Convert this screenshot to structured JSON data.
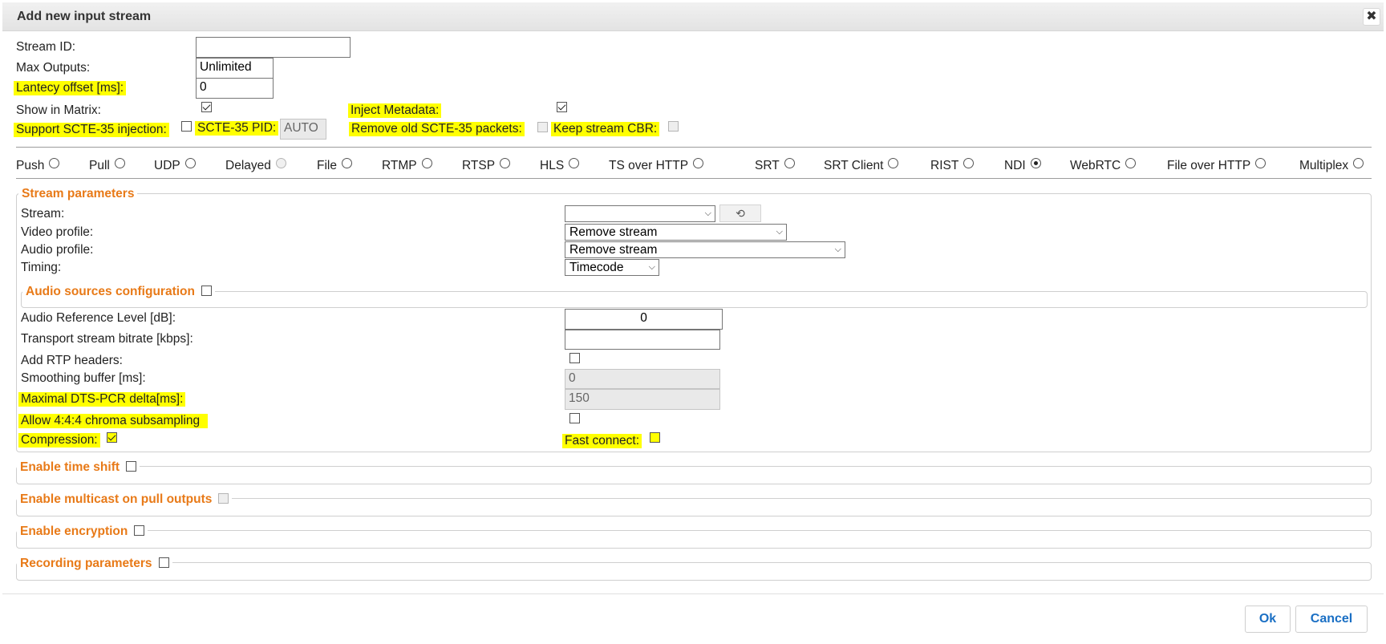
{
  "dialog": {
    "title": "Add new input stream",
    "close_icon": "close-icon"
  },
  "top": {
    "stream_id_label": "Stream ID:",
    "stream_id_value": "",
    "max_outputs_label": "Max Outputs:",
    "max_outputs_value": "Unlimited",
    "latency_label": "Lantecy offset [ms]:",
    "latency_value": "0",
    "show_matrix_label": "Show in Matrix:",
    "show_matrix_checked": true,
    "inject_metadata_label": "Inject Metadata:",
    "inject_metadata_checked": true,
    "scte_injection_label": "Support SCTE-35 injection:",
    "scte_pid_label": "SCTE-35 PID:",
    "scte_pid_value": "AUTO",
    "remove_scte_label": "Remove old SCTE-35 packets:",
    "keep_cbr_label": "Keep stream CBR:"
  },
  "protocols": [
    {
      "label": "Push",
      "selected": false,
      "disabled": false
    },
    {
      "label": "Pull",
      "selected": false,
      "disabled": false
    },
    {
      "label": "UDP",
      "selected": false,
      "disabled": false
    },
    {
      "label": "Delayed",
      "selected": false,
      "disabled": true
    },
    {
      "label": "File",
      "selected": false,
      "disabled": false
    },
    {
      "label": "RTMP",
      "selected": false,
      "disabled": false
    },
    {
      "label": "RTSP",
      "selected": false,
      "disabled": false
    },
    {
      "label": "HLS",
      "selected": false,
      "disabled": false
    },
    {
      "label": "TS over HTTP",
      "selected": false,
      "disabled": false
    },
    {
      "label": "SRT",
      "selected": false,
      "disabled": false
    },
    {
      "label": "SRT Client",
      "selected": false,
      "disabled": false
    },
    {
      "label": "RIST",
      "selected": false,
      "disabled": false
    },
    {
      "label": "NDI",
      "selected": true,
      "disabled": false
    },
    {
      "label": "WebRTC",
      "selected": false,
      "disabled": false
    },
    {
      "label": "File over HTTP",
      "selected": false,
      "disabled": false
    },
    {
      "label": "Multiplex",
      "selected": false,
      "disabled": false
    }
  ],
  "stream_params": {
    "legend": "Stream parameters",
    "stream_label": "Stream:",
    "stream_value": "",
    "refresh_icon": "refresh-icon",
    "video_profile_label": "Video profile:",
    "video_profile_value": "Remove stream",
    "audio_profile_label": "Audio profile:",
    "audio_profile_value": "Remove stream",
    "timing_label": "Timing:",
    "timing_value": "Timecode",
    "audio_sources_legend": "Audio sources configuration",
    "audio_ref_label": "Audio Reference Level [dB]:",
    "audio_ref_value": "0",
    "ts_bitrate_label": "Transport stream bitrate [kbps]:",
    "ts_bitrate_value": "",
    "rtp_headers_label": "Add RTP headers:",
    "smoothing_label": "Smoothing buffer [ms]:",
    "smoothing_value": "0",
    "dts_pcr_label": "Maximal DTS-PCR delta[ms]:",
    "dts_pcr_value": "150",
    "chroma_label": "Allow 4:4:4 chroma subsampling",
    "compression_label": "Compression:",
    "compression_checked": true,
    "fast_connect_label": "Fast connect:"
  },
  "sections": {
    "time_shift": "Enable time shift",
    "multicast": "Enable multicast on pull outputs",
    "encryption": "Enable encryption",
    "recording": "Recording parameters"
  },
  "footer": {
    "ok_label": "Ok",
    "cancel_label": "Cancel"
  },
  "colors": {
    "accent_orange": "#e87a18",
    "highlight_yellow": "#ffff00",
    "button_blue": "#1a6fc4"
  }
}
